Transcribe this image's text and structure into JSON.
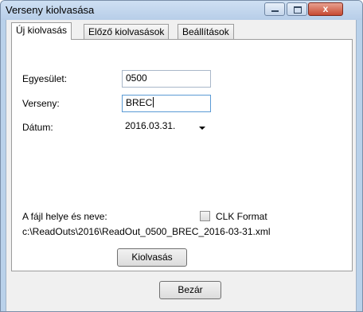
{
  "window": {
    "title": "Verseny kiolvasása",
    "close_glyph": "x"
  },
  "tabs": [
    {
      "label": "Új kiolvasás",
      "active": true
    },
    {
      "label": "Előző kiolvasások",
      "active": false
    },
    {
      "label": "Beállítások",
      "active": false
    }
  ],
  "form": {
    "club_label": "Egyesület:",
    "club_value": "0500",
    "race_label": "Verseny:",
    "race_value": "BREC",
    "date_label": "Dátum:",
    "date_value": "2016.03.31.",
    "file_location_label": "A fájl helye és neve:",
    "clk_format_label": "CLK Format",
    "clk_format_checked": false,
    "file_path": "c:\\ReadOuts\\2016\\ReadOut_0500_BREC_2016-03-31.xml",
    "read_button": "Kiolvasás"
  },
  "footer": {
    "close_button": "Bezár"
  }
}
